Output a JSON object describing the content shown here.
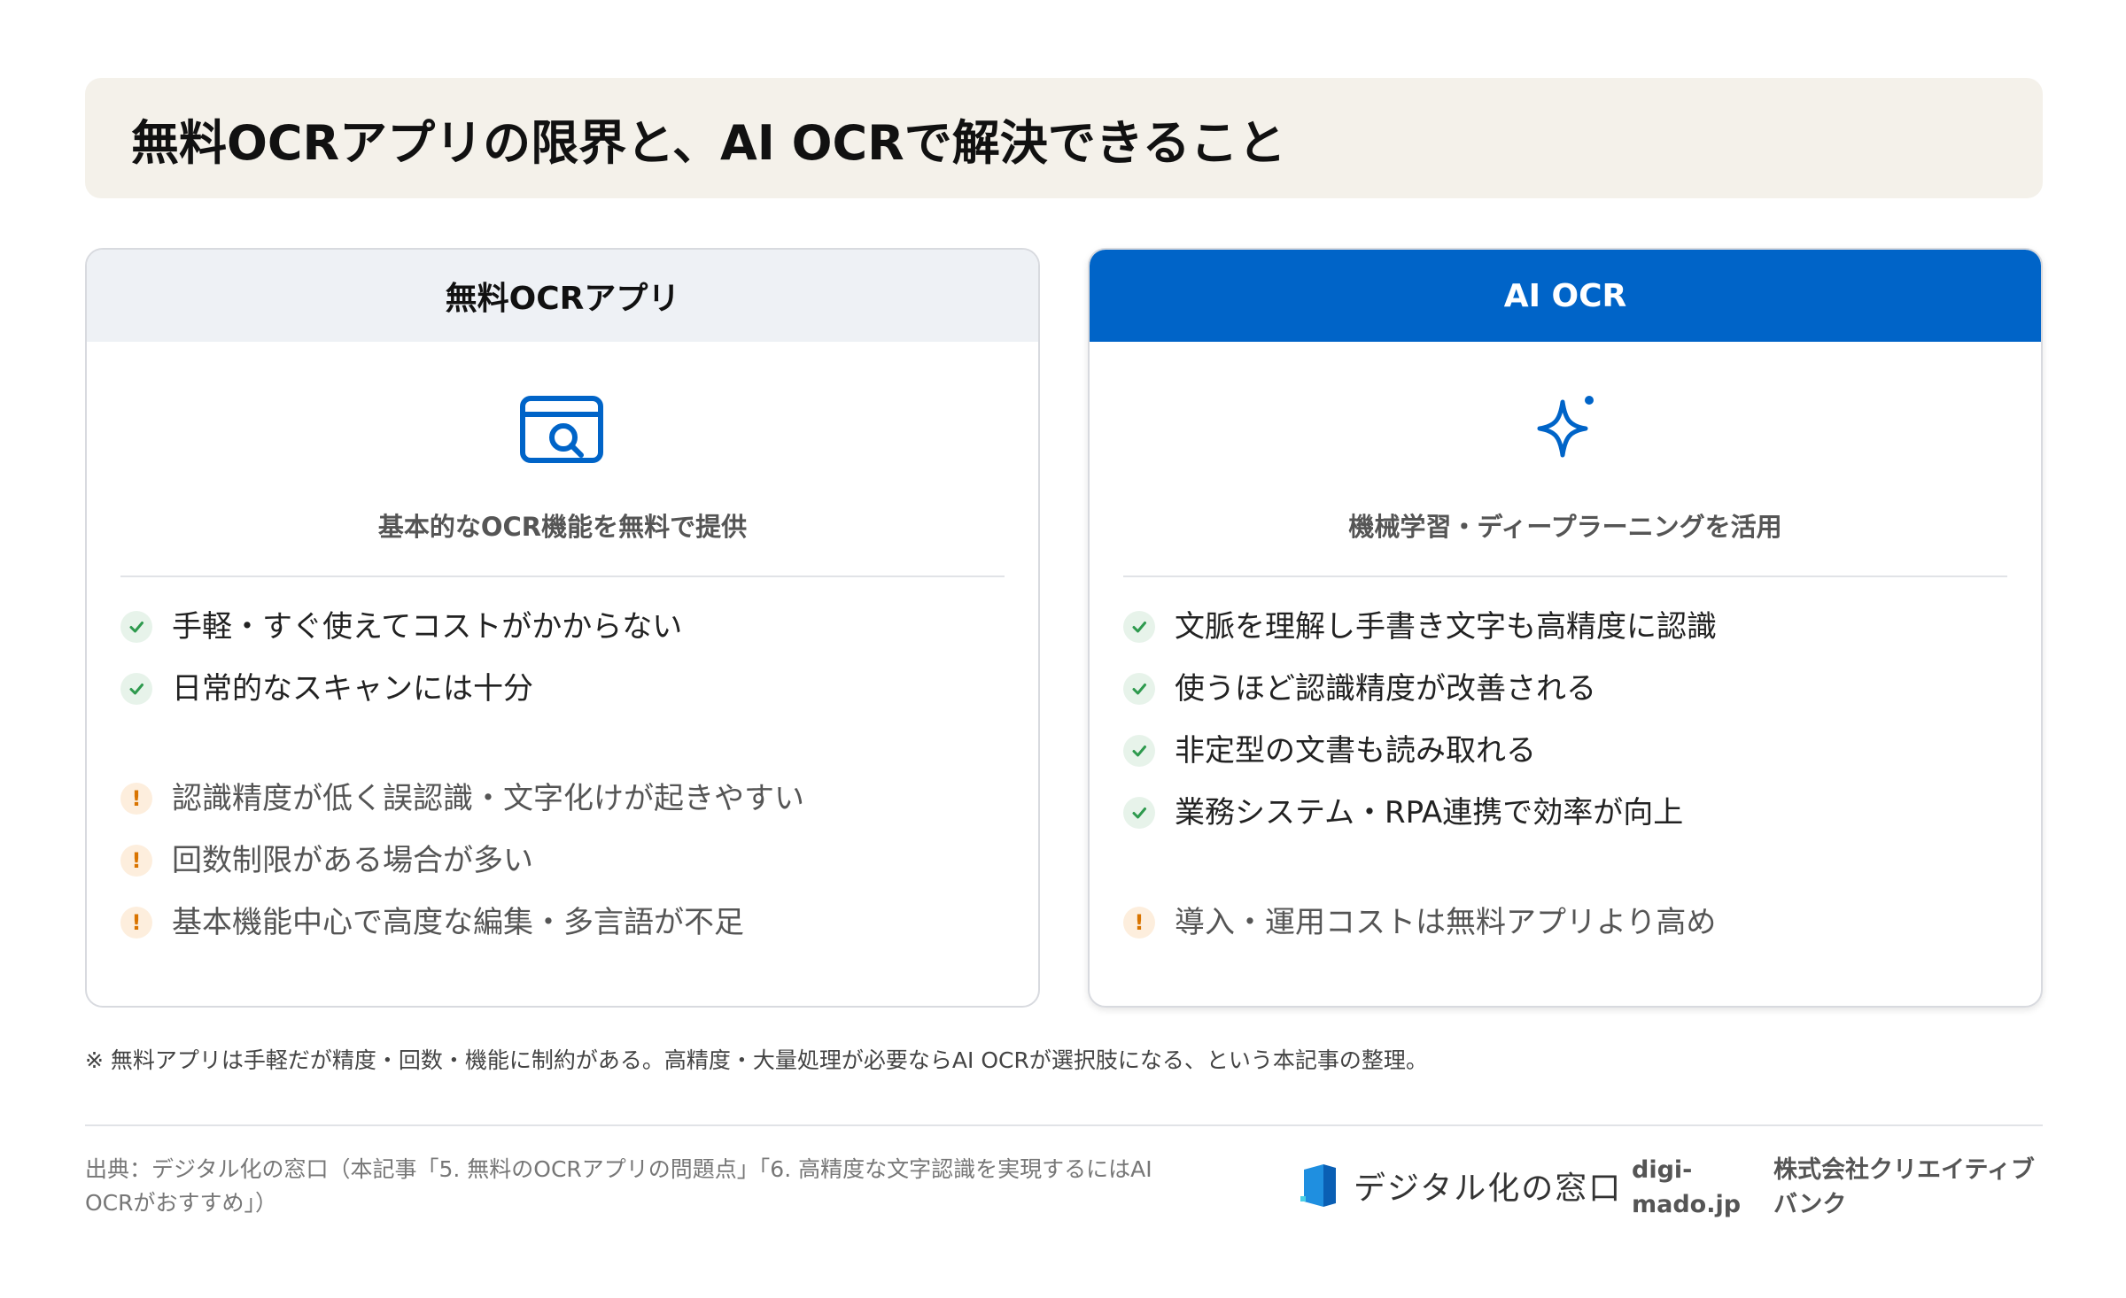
{
  "title": "無料OCRアプリの限界と、AI OCRで解決できること",
  "left_card": {
    "heading": "無料OCRアプリ",
    "icon": "document-search-icon",
    "subtitle": "基本的なOCR機能を無料で提供",
    "pros": [
      "手軽・すぐ使えてコストがかからない",
      "日常的なスキャンには十分"
    ],
    "cons": [
      "認識精度が低く誤認識・文字化けが起きやすい",
      "回数制限がある場合が多い",
      "基本機能中心で高度な編集・多言語が不足"
    ]
  },
  "right_card": {
    "heading": "AI OCR",
    "icon": "sparkle-icon",
    "subtitle": "機械学習・ディープラーニングを活用",
    "pros": [
      "文脈を理解し手書き文字も高精度に認識",
      "使うほど認識精度が改善される",
      "非定型の文書も読み取れる",
      "業務システム・RPA連携で効率が向上"
    ],
    "cons": [
      "導入・運用コストは無料アプリより高め"
    ]
  },
  "warn_symbol": "!",
  "note": "※ 無料アプリは手軽だが精度・回数・機能に制約がある。高精度・大量処理が必要ならAI OCRが選択肢になる、という本記事の整理。",
  "source": "出典：デジタル化の窓口（本記事「5. 無料のOCRアプリの問題点」「6. 高精度な文字認識を実現するにはAI OCRがおすすめ」）",
  "brand": {
    "name": "デジタル化の窓口",
    "domain": "digi-mado.jp",
    "company": "株式会社クリエイティブバンク"
  },
  "colors": {
    "accent": "#0064c8",
    "check": "#2e9a4e",
    "warn": "#d97400",
    "title_band": "#f4f1ea"
  }
}
